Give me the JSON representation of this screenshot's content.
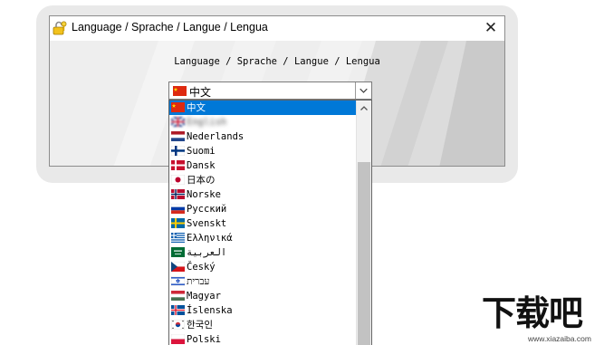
{
  "window": {
    "title": "Language / Sprache  / Langue / Lengua",
    "close_glyph": "✕"
  },
  "dialog": {
    "prompt": "Language / Sprache  / Langue / Lengua"
  },
  "combo": {
    "selected_value": "中文",
    "selected_flag": "china"
  },
  "dropdown": {
    "items": [
      {
        "label": "中文",
        "flag": "china",
        "selected": true
      },
      {
        "label": "English",
        "flag": "uk",
        "blurred": true
      },
      {
        "label": "Nederlands",
        "flag": "netherlands"
      },
      {
        "label": "Suomi",
        "flag": "finland"
      },
      {
        "label": "Dansk",
        "flag": "denmark"
      },
      {
        "label": "日本の",
        "flag": "japan"
      },
      {
        "label": "Norske",
        "flag": "norway"
      },
      {
        "label": "Русский",
        "flag": "russia"
      },
      {
        "label": "Svenskt",
        "flag": "sweden"
      },
      {
        "label": "Ελληνικά",
        "flag": "greece"
      },
      {
        "label": "العربية",
        "flag": "saudi"
      },
      {
        "label": "Český",
        "flag": "czech"
      },
      {
        "label": "עברית",
        "flag": "israel"
      },
      {
        "label": "Magyar",
        "flag": "hungary"
      },
      {
        "label": "Íslenska",
        "flag": "iceland"
      },
      {
        "label": "한국인",
        "flag": "korea"
      },
      {
        "label": "Polski",
        "flag": "poland"
      }
    ]
  },
  "watermark": {
    "text": "下载吧",
    "url": "www.xiazaiba.com"
  },
  "icons": {
    "title_icon": "padlock-key-icon",
    "combo_arrow": "chevron-down-icon",
    "scroll_up": "chevron-up-icon"
  },
  "colors": {
    "selection": "#0078d7",
    "client_background": "#ebebeb"
  }
}
